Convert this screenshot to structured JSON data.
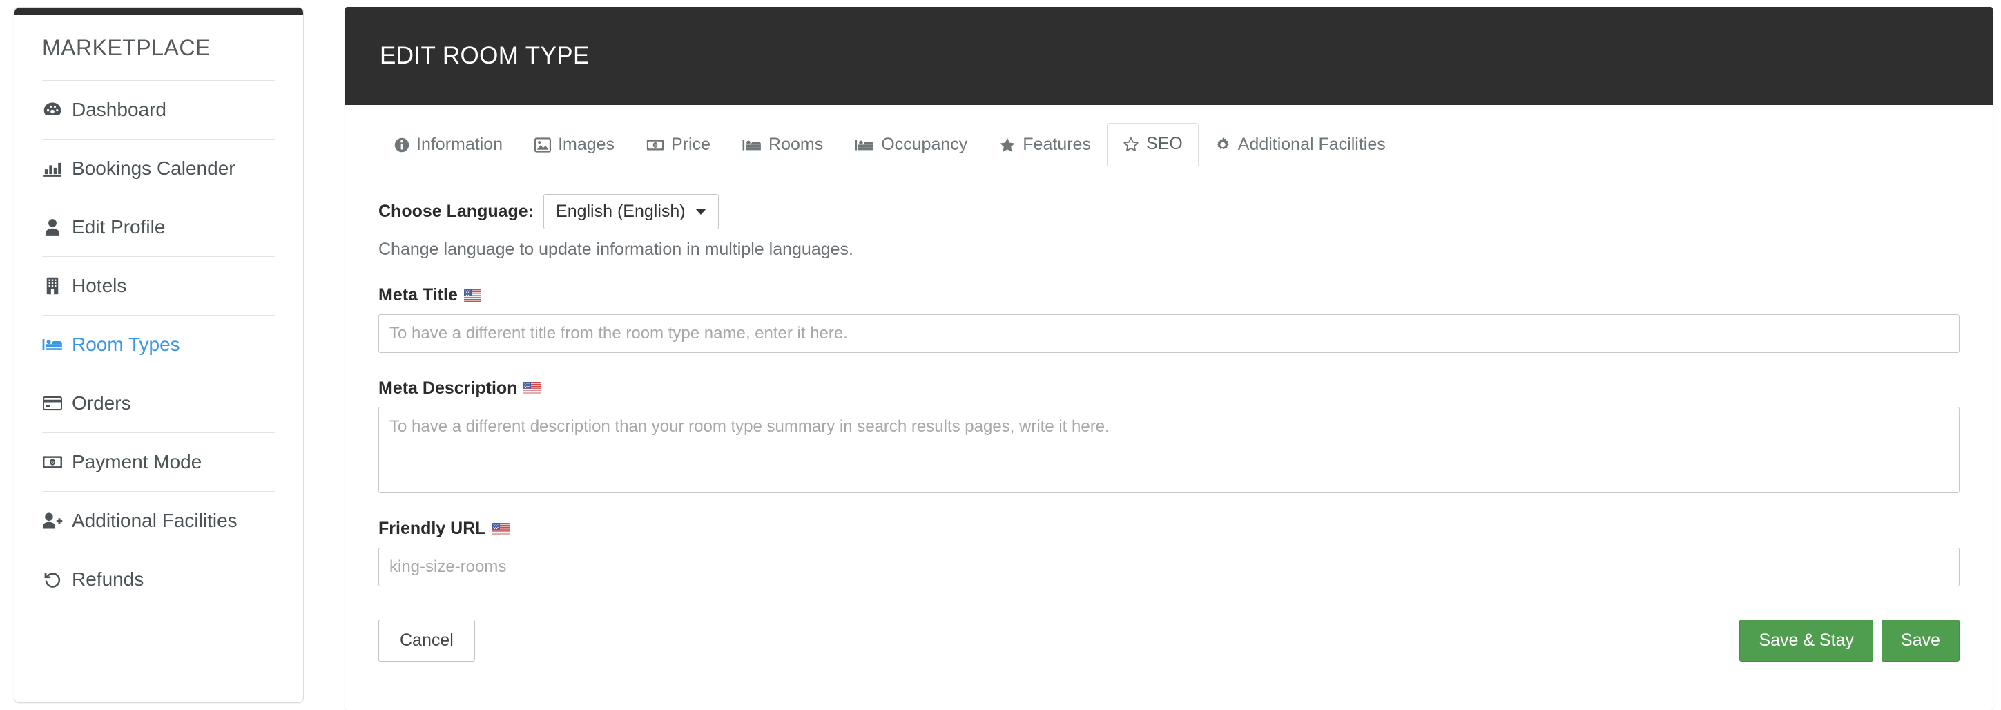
{
  "sidebar": {
    "brand": "MARKETPLACE",
    "items": [
      {
        "label": "Dashboard",
        "icon": "dashboard-icon",
        "active": false
      },
      {
        "label": "Bookings Calender",
        "icon": "bar-chart-icon",
        "active": false
      },
      {
        "label": "Edit Profile",
        "icon": "user-icon",
        "active": false
      },
      {
        "label": "Hotels",
        "icon": "building-icon",
        "active": false
      },
      {
        "label": "Room Types",
        "icon": "bed-icon",
        "active": true
      },
      {
        "label": "Orders",
        "icon": "credit-card-icon",
        "active": false
      },
      {
        "label": "Payment Mode",
        "icon": "money-bill-icon",
        "active": false
      },
      {
        "label": "Additional Facilities",
        "icon": "user-plus-icon",
        "active": false
      },
      {
        "label": "Refunds",
        "icon": "undo-icon",
        "active": false
      }
    ]
  },
  "header": {
    "title": "EDIT ROOM TYPE"
  },
  "tabs": [
    {
      "label": "Information",
      "icon": "info-circle-icon",
      "active": false
    },
    {
      "label": "Images",
      "icon": "image-icon",
      "active": false
    },
    {
      "label": "Price",
      "icon": "money-bill-icon",
      "active": false
    },
    {
      "label": "Rooms",
      "icon": "bed-icon",
      "active": false
    },
    {
      "label": "Occupancy",
      "icon": "bed-icon",
      "active": false
    },
    {
      "label": "Features",
      "icon": "star-icon",
      "active": false
    },
    {
      "label": "SEO",
      "icon": "star-o-icon",
      "active": true
    },
    {
      "label": "Additional Facilities",
      "icon": "gear-icon",
      "active": false
    }
  ],
  "language": {
    "label": "Choose Language:",
    "selected": "English (English)",
    "help": "Change language to update information in multiple languages.",
    "options": [
      "English (English)"
    ]
  },
  "fields": {
    "meta_title": {
      "label": "Meta Title",
      "flag": "us-flag-icon",
      "value": "",
      "placeholder": "To have a different title from the room type name, enter it here."
    },
    "meta_description": {
      "label": "Meta Description",
      "flag": "us-flag-icon",
      "value": "",
      "placeholder": "To have a different description than your room type summary in search results pages, write it here."
    },
    "friendly_url": {
      "label": "Friendly URL",
      "flag": "us-flag-icon",
      "value": "",
      "placeholder": "king-size-rooms"
    }
  },
  "buttons": {
    "cancel": "Cancel",
    "save_and_stay": "Save & Stay",
    "save": "Save"
  },
  "colors": {
    "header_dark": "#2f2f2f",
    "accent_blue": "#3b97e3",
    "save_green": "#4f9d4f"
  }
}
